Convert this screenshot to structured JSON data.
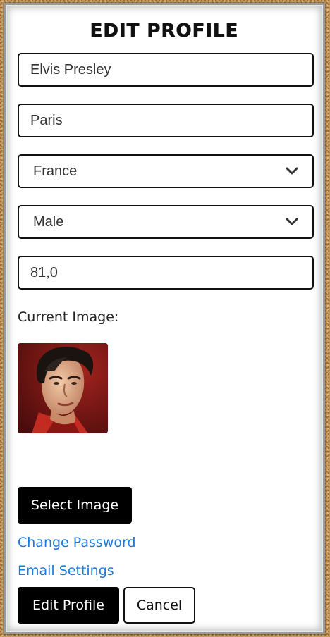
{
  "form": {
    "title": "EDIT PROFILE",
    "name_value": "Elvis Presley",
    "city_value": "Paris",
    "country_value": "France",
    "gender_value": "Male",
    "weight_value": "81,0",
    "current_image_label": "Current Image:"
  },
  "actions": {
    "select_image": "Select Image",
    "change_password": "Change Password",
    "email_settings": "Email Settings",
    "edit_profile": "Edit Profile",
    "cancel": "Cancel"
  },
  "colors": {
    "link": "#1a78e0",
    "button_dark": "#000000",
    "photo_background": "#6b1414"
  }
}
